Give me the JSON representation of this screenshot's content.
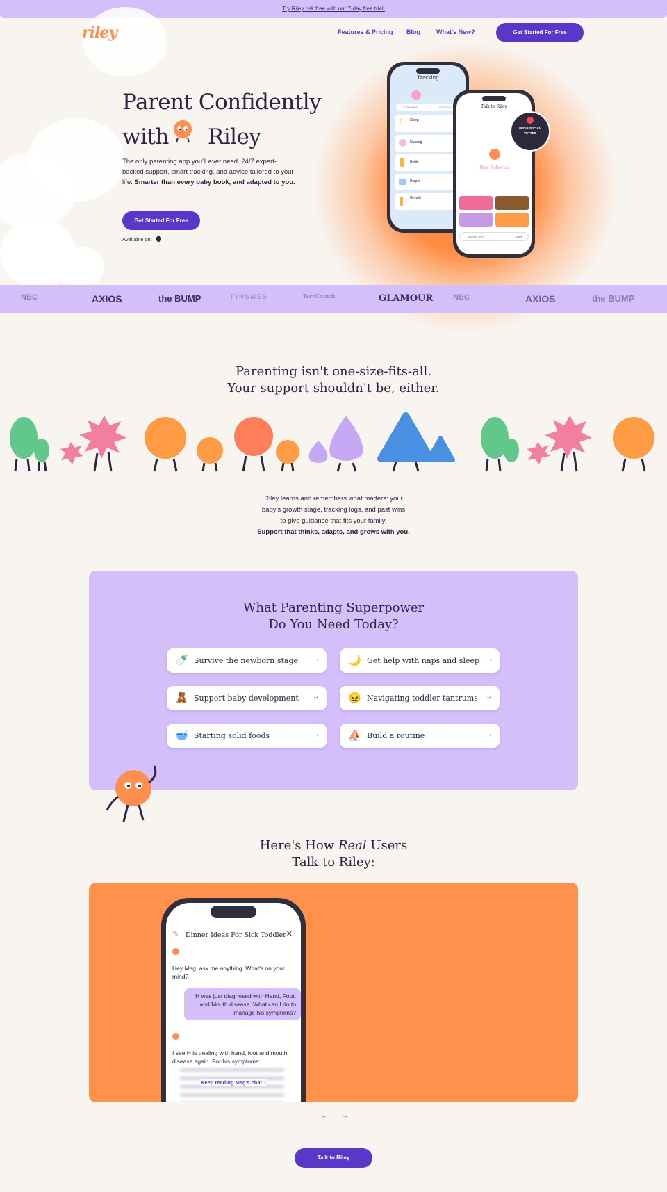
{
  "promo": {
    "text": "Try Riley risk free with our 7-day free trial!"
  },
  "brand": {
    "logo": "riley",
    "accent": "#5a36c9",
    "lavender": "#d4bffb",
    "orange": "#ff914d",
    "bg": "#f8f5f1"
  },
  "nav": {
    "items": [
      "Features & Pricing",
      "Blog",
      "What's New?"
    ],
    "cta": "Get Started For Free"
  },
  "hero": {
    "title_line1": "Parent Confidently",
    "title_with": "with",
    "title_riley": "Riley",
    "desc_plain": "The only parenting app you'll ever need. 24/7 expert-backed support, smart tracking, and advice tailored to your life.",
    "desc_bold": "Smarter than every baby book, and adapted to you.",
    "cta": "Get Started For Free",
    "available": "Available on:",
    "available_icon": "apple-icon"
  },
  "phone_tracking": {
    "title": "Tracking",
    "tabs": [
      "LOGGING",
      "HISTORY"
    ],
    "rows": [
      "Sleep",
      "Nursing",
      "Bottle",
      "Diaper",
      "Growth"
    ]
  },
  "phone_talk": {
    "title": "Talk to Riley",
    "greeting": "Hey, Rebecca",
    "input_placeholder": "Talk with Riley",
    "input_mode": "Voice"
  },
  "seal": {
    "text": "PEDIATRICIAN VETTED"
  },
  "press": {
    "logos": [
      "NBC",
      "AXIOS",
      "the BUMP",
      "FINSMES",
      "TechCrunch",
      "GLAMOUR",
      "NBC",
      "AXIOS",
      "the BUMP"
    ]
  },
  "support": {
    "heading_line1": "Parenting isn't one-size-fits-all.",
    "heading_line2": "Your support shouldn't be, either.",
    "para_line1": "Riley learns and remembers what matters: your",
    "para_line2": "baby's growth stage, tracking logs, and past wins",
    "para_line3": "to give guidance that fits your family.",
    "para_bold": "Support that thinks, adapts, and grows with you."
  },
  "superpower": {
    "heading_line1": "What Parenting Superpower",
    "heading_line2": "Do You Need Today?",
    "options": [
      {
        "label": "Survive the newborn stage",
        "icon": "baby-bottle-icon"
      },
      {
        "label": "Get help with naps and sleep",
        "icon": "moon-icon"
      },
      {
        "label": "Support baby development",
        "icon": "blocks-icon"
      },
      {
        "label": "Navigating toddler tantrums",
        "icon": "face-icon"
      },
      {
        "label": "Starting solid foods",
        "icon": "bowl-icon"
      },
      {
        "label": "Build a routine",
        "icon": "boat-icon"
      }
    ]
  },
  "real_users": {
    "heading_line1": "Here's How",
    "heading_real": "Real",
    "heading_users": "Users",
    "heading_line2": "Talk to Riley:",
    "chat_title": "Dinner Ideas For Sick Toddler",
    "bot_msg1": "Hey Meg, ask me anything. What's on your mind?",
    "user_msg": "H was just diagnosed with Hand, Foot, and Mouth disease. What can I do to manage his symptoms?",
    "bot_msg2": "I see H is dealing with hand, foot and mouth disease again. For his symptoms:",
    "read_more": "Keep reading Meg's chat ↓"
  },
  "carousel": {
    "prev": "←",
    "next": "→"
  },
  "bottom": {
    "cta": "Talk to Riley"
  }
}
